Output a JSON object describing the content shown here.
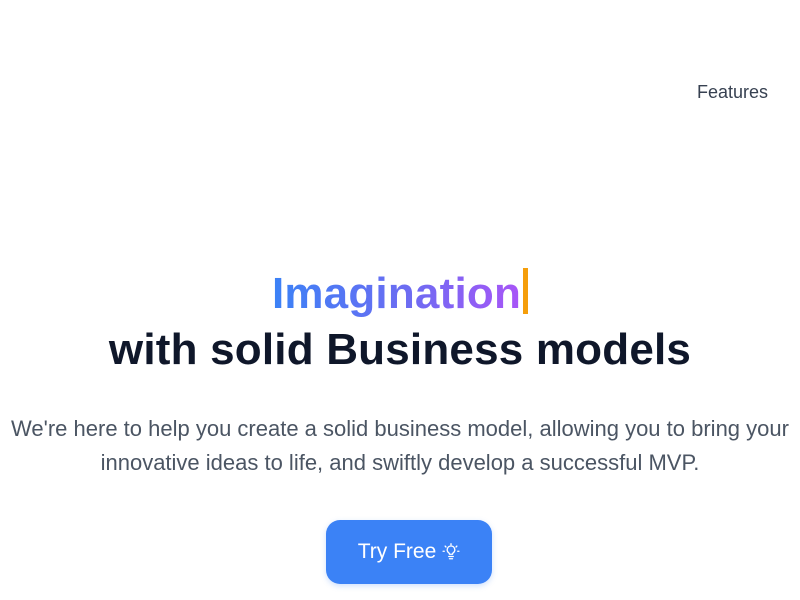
{
  "nav": {
    "features_label": "Features"
  },
  "hero": {
    "highlight": "Imagination",
    "headline_rest": "with solid Business models",
    "subtitle": "We're here to help you create a solid business model, allowing you to bring your innovative ideas to life, and swiftly develop a successful MVP.",
    "cta_label": "Try Free",
    "cta_icon": "lightbulb-icon"
  },
  "colors": {
    "accent": "#3b82f6",
    "gradient_start": "#3b82f6",
    "gradient_end": "#a855f7",
    "caret": "#f59e0b",
    "headline": "#0f172a"
  }
}
